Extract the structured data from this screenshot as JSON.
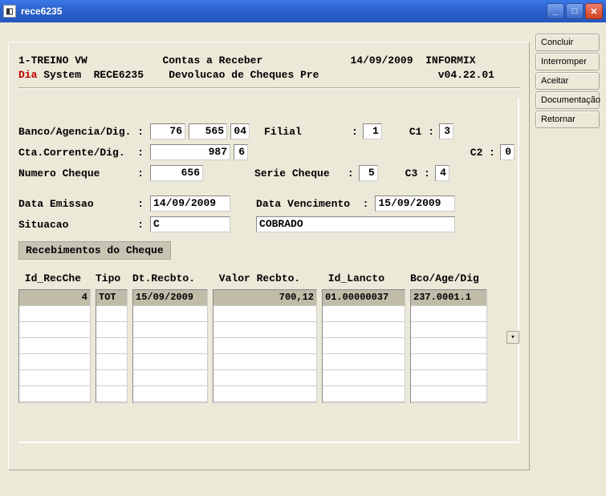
{
  "window": {
    "title": "rece6235"
  },
  "sidebar": {
    "items": [
      {
        "label": "Concluir"
      },
      {
        "label": "Interromper"
      },
      {
        "label": "Aceitar"
      },
      {
        "label": "Documentação"
      },
      {
        "label": "Retornar"
      }
    ]
  },
  "header": {
    "company": "1-TREINO VW",
    "module": "Contas a Receber",
    "date": "14/09/2009",
    "db": "INFORMIX",
    "dia": "Dia",
    "system": " System  RECE6235",
    "subtitle": "Devolucao de Cheques Pre",
    "version": "v04.22.01"
  },
  "form": {
    "labels": {
      "banco": "Banco/Agencia/Dig. :",
      "filial": "Filial",
      "c1": "C1 :",
      "cta": "Cta.Corrente/Dig.  :",
      "c2": "C2 :",
      "numcheque": "Numero Cheque      :",
      "serie": "Serie Cheque",
      "c3": "C3 :",
      "emissao": "Data Emissao       :",
      "venc": "Data Vencimento  :",
      "situacao": "Situacao           :"
    },
    "values": {
      "banco": "76",
      "agencia": "565",
      "dig1": "04",
      "filial": "1",
      "c1": "3",
      "conta": "987",
      "dig2": "6",
      "c2": "0",
      "numcheque": "656",
      "serie": "5",
      "c3": "4",
      "emissao": "14/09/2009",
      "venc": "15/09/2009",
      "sit_code": "C",
      "sit_desc": "COBRADO"
    }
  },
  "sub": {
    "title": "Recebimentos do Cheque"
  },
  "grid": {
    "headers": {
      "id": " Id_RecChe",
      "tipo": "Tipo",
      "dtrec": "Dt.Recbto.",
      "valor": " Valor Recbto.",
      "idlan": " Id_Lancto",
      "bco": "Bco/Age/Dig"
    },
    "row0": {
      "id": "4",
      "tipo": "TOT",
      "dtrec": "15/09/2009",
      "valor": "700,12",
      "idlan": "01.00000037",
      "bco": "237.0001.1"
    }
  }
}
